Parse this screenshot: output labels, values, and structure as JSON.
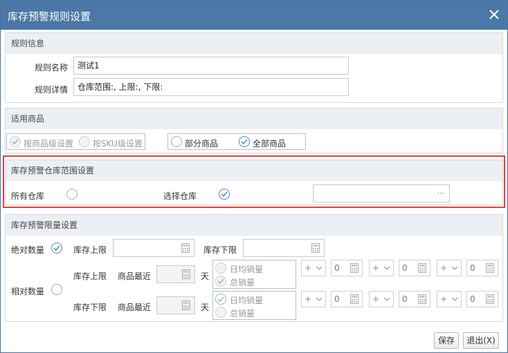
{
  "dialog": {
    "title": "库存预警规则设置"
  },
  "rule_info": {
    "section_title": "规则信息",
    "name_label": "规则名称",
    "name_value": "测试1",
    "detail_label": "规则详情",
    "detail_value": "仓库范围:, 上限:, 下限:"
  },
  "goods": {
    "section_title": "适用商品",
    "by_goods_label": "按商品级设置",
    "by_goods_checked": true,
    "by_sku_label": "按SKU级设置",
    "by_sku_checked": false,
    "partial_label": "部分商品",
    "partial_checked": false,
    "all_label": "全部商品",
    "all_checked": true
  },
  "warehouse": {
    "section_title": "库存预警仓库范围设置",
    "all_label": "所有仓库",
    "all_checked": false,
    "select_label": "选择仓库",
    "select_checked": true,
    "picker_button": "···",
    "highlight_color": "#e53e3e"
  },
  "limit": {
    "section_title": "库存预警限量设置",
    "absolute_label": "绝对数量",
    "absolute_checked": true,
    "abs_upper_label": "库存上限",
    "abs_lower_label": "库存下限",
    "relative_label": "相对数量",
    "relative_checked": false,
    "rows": [
      {
        "limit_label": "库存上限",
        "recent_label": "商品最近",
        "day_unit": "天",
        "daily_label": "日均销量",
        "daily_checked": false,
        "total_label": "总销量",
        "total_checked": true,
        "ops": [
          {
            "op": "+",
            "value": "0"
          },
          {
            "op": "+",
            "value": "0"
          },
          {
            "op": "+",
            "value": "0"
          }
        ]
      },
      {
        "limit_label": "库存下限",
        "recent_label": "商品最近",
        "day_unit": "天",
        "daily_label": "日均销量",
        "daily_checked": true,
        "total_label": "总销量",
        "total_checked": false,
        "ops": [
          {
            "op": "+",
            "value": "0"
          },
          {
            "op": "+",
            "value": "0"
          },
          {
            "op": "+",
            "value": "0"
          }
        ]
      }
    ]
  },
  "footer": {
    "save_label": "保存",
    "exit_label": "退出(X)"
  },
  "colors": {
    "titlebar": "#4b78a6",
    "accent": "#4a86c5",
    "highlight": "#e53e3e"
  }
}
